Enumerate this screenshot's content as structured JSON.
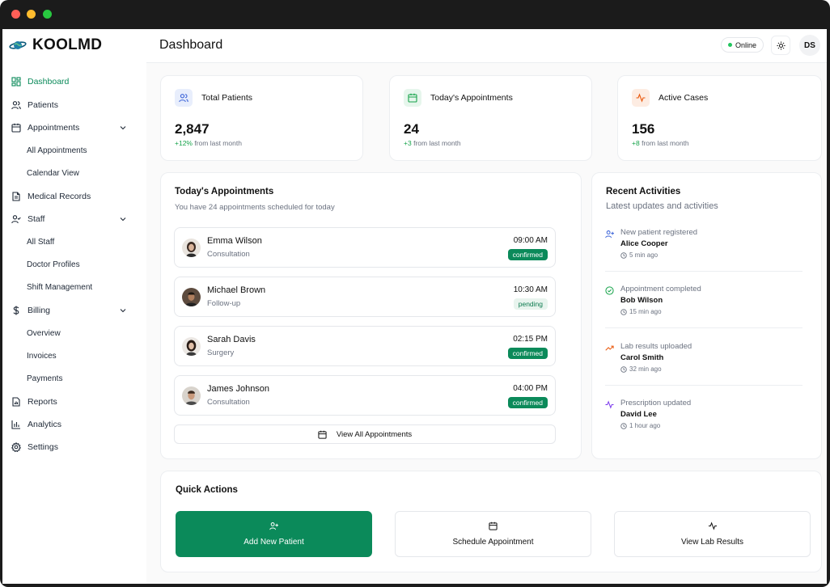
{
  "brand": {
    "name": "KOOLMD"
  },
  "header": {
    "title": "Dashboard",
    "status": "Online",
    "user_initials": "DS"
  },
  "sidebar": {
    "items": [
      {
        "label": "Dashboard"
      },
      {
        "label": "Patients"
      },
      {
        "label": "Appointments"
      },
      {
        "label": "All Appointments"
      },
      {
        "label": "Calendar View"
      },
      {
        "label": "Medical Records"
      },
      {
        "label": "Staff"
      },
      {
        "label": "All Staff"
      },
      {
        "label": "Doctor Profiles"
      },
      {
        "label": "Shift Management"
      },
      {
        "label": "Billing"
      },
      {
        "label": "Overview"
      },
      {
        "label": "Invoices"
      },
      {
        "label": "Payments"
      },
      {
        "label": "Reports"
      },
      {
        "label": "Analytics"
      },
      {
        "label": "Settings"
      }
    ]
  },
  "stats": [
    {
      "title": "Total Patients",
      "value": "2,847",
      "change": "+12%",
      "change_suffix": "from last month",
      "icon": "users-icon",
      "icon_bg": "#e8eefc",
      "icon_color": "#3b63d8"
    },
    {
      "title": "Today's Appointments",
      "value": "24",
      "change": "+3",
      "change_suffix": "from last month",
      "icon": "calendar-icon",
      "icon_bg": "#e6f6ec",
      "icon_color": "#16a34a"
    },
    {
      "title": "Active Cases",
      "value": "156",
      "change": "+8",
      "change_suffix": "from last month",
      "icon": "activity-icon",
      "icon_bg": "#fdece2",
      "icon_color": "#ea580c"
    }
  ],
  "appointments": {
    "title": "Today's Appointments",
    "subtitle": "You have 24 appointments scheduled for today",
    "items": [
      {
        "name": "Emma Wilson",
        "type": "Consultation",
        "time": "09:00 AM",
        "status": "confirmed"
      },
      {
        "name": "Michael Brown",
        "type": "Follow-up",
        "time": "10:30 AM",
        "status": "pending"
      },
      {
        "name": "Sarah Davis",
        "type": "Surgery",
        "time": "02:15 PM",
        "status": "confirmed"
      },
      {
        "name": "James Johnson",
        "type": "Consultation",
        "time": "04:00 PM",
        "status": "confirmed"
      }
    ],
    "view_all_label": "View All Appointments"
  },
  "activities": {
    "title": "Recent Activities",
    "subtitle": "Latest updates and activities",
    "items": [
      {
        "title": "New patient registered",
        "name": "Alice Cooper",
        "time": "5 min ago",
        "icon": "user-plus-icon",
        "color": "#3b63d8"
      },
      {
        "title": "Appointment completed",
        "name": "Bob Wilson",
        "time": "15 min ago",
        "icon": "check-circle-icon",
        "color": "#16a34a"
      },
      {
        "title": "Lab results uploaded",
        "name": "Carol Smith",
        "time": "32 min ago",
        "icon": "trending-up-icon",
        "color": "#ea580c"
      },
      {
        "title": "Prescription updated",
        "name": "David Lee",
        "time": "1 hour ago",
        "icon": "activity-icon",
        "color": "#7c3aed"
      }
    ]
  },
  "quick_actions": {
    "title": "Quick Actions",
    "items": [
      {
        "label": "Add New Patient",
        "icon": "user-plus-icon"
      },
      {
        "label": "Schedule Appointment",
        "icon": "calendar-icon"
      },
      {
        "label": "View Lab Results",
        "icon": "activity-icon"
      }
    ]
  },
  "colors": {
    "accent": "#0b8a5a",
    "online": "#22c55e"
  }
}
